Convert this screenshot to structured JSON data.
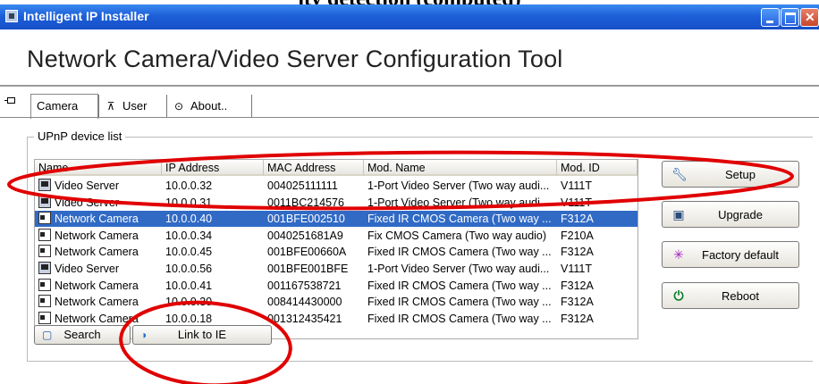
{
  "top_heading": "ity detection  (computed)",
  "window": {
    "title": "Intelligent IP Installer"
  },
  "app_heading": "Network Camera/Video Server Configuration Tool",
  "tabs": [
    {
      "label": "Camera",
      "icon": "camera-icon"
    },
    {
      "label": "User",
      "icon": "user-icon"
    },
    {
      "label": "About..",
      "icon": "info-icon"
    }
  ],
  "group_label": "UPnP device list",
  "table": {
    "columns": [
      "Name",
      "IP Address",
      "MAC Address",
      "Mod. Name",
      "Mod. ID"
    ],
    "rows": [
      {
        "type": "server",
        "name": "Video Server",
        "ip": "10.0.0.32",
        "mac": "004025111111",
        "model": "1-Port Video Server (Two way audi...",
        "id": "V111T"
      },
      {
        "type": "server",
        "name": "Video Server",
        "ip": "10.0.0.31",
        "mac": "0011BC214576",
        "model": "1-Port Video Server (Two way audi...",
        "id": "V111T"
      },
      {
        "type": "camera",
        "name": "Network Camera",
        "ip": "10.0.0.40",
        "mac": "001BFE002510",
        "model": "Fixed IR CMOS Camera (Two way ...",
        "id": "F312A",
        "selected": true
      },
      {
        "type": "camera",
        "name": "Network Camera",
        "ip": "10.0.0.34",
        "mac": "0040251681A9",
        "model": "Fix CMOS Camera (Two way audio)",
        "id": "F210A"
      },
      {
        "type": "camera",
        "name": "Network Camera",
        "ip": "10.0.0.45",
        "mac": "001BFE00660A",
        "model": "Fixed IR CMOS Camera (Two way ...",
        "id": "F312A"
      },
      {
        "type": "server",
        "name": "Video Server",
        "ip": "10.0.0.56",
        "mac": "001BFE001BFE",
        "model": "1-Port Video Server (Two way audi...",
        "id": "V111T"
      },
      {
        "type": "camera",
        "name": "Network Camera",
        "ip": "10.0.0.41",
        "mac": "001167538721",
        "model": "Fixed IR CMOS Camera (Two way ...",
        "id": "F312A"
      },
      {
        "type": "camera",
        "name": "Network Camera",
        "ip": "10.0.0.30",
        "mac": "008414430000",
        "model": "Fixed IR CMOS Camera (Two way ...",
        "id": "F312A"
      },
      {
        "type": "camera",
        "name": "Network Camera",
        "ip": "10.0.0.18",
        "mac": "001312435421",
        "model": "Fixed IR CMOS Camera (Two way ...",
        "id": "F312A"
      }
    ]
  },
  "side_buttons": [
    {
      "label": "Setup",
      "icon": "wrench-icon"
    },
    {
      "label": "Upgrade",
      "icon": "upgrade-icon"
    },
    {
      "label": "Factory default",
      "icon": "factory-default-icon"
    },
    {
      "label": "Reboot",
      "icon": "power-icon"
    }
  ],
  "bottom_buttons": {
    "search": "Search",
    "link_ie": "Link to IE"
  },
  "colors": {
    "titlebar": "#1d5fd8",
    "selection": "#316ac5",
    "annotation": "#e00000"
  }
}
